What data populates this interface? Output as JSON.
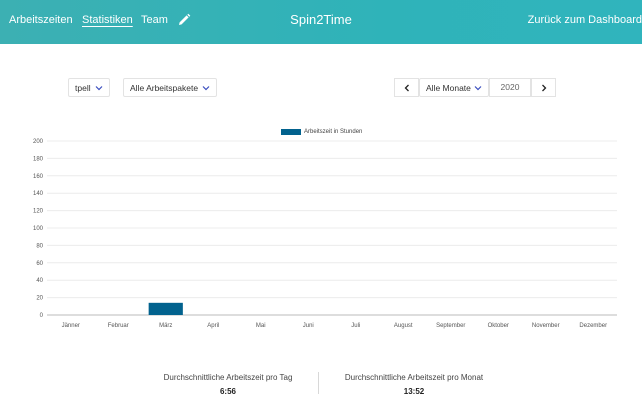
{
  "header": {
    "nav": [
      {
        "label": "Arbeitszeiten",
        "active": false
      },
      {
        "label": "Statistiken",
        "active": true
      },
      {
        "label": "Team",
        "active": false
      }
    ],
    "edit_icon": "pencil-icon",
    "title": "Spin2Time",
    "back_label": "Zurück zum Dashboard"
  },
  "filters": {
    "user_select": "tpell",
    "package_select": "Alle Arbeitspakete",
    "month_select": "Alle Monate",
    "year_value": "2020",
    "prev_icon": "chevron-left-icon",
    "next_icon": "chevron-right-icon"
  },
  "colors": {
    "header_bg": "#34b2b7",
    "bar": "#02628e"
  },
  "chart_data": {
    "type": "bar",
    "categories": [
      "Jänner",
      "Februar",
      "März",
      "April",
      "Mai",
      "Juni",
      "Juli",
      "August",
      "September",
      "Oktober",
      "November",
      "Dezember"
    ],
    "series": [
      {
        "name": "Arbeitszeit in Stunden",
        "values": [
          0,
          0,
          14,
          0,
          0,
          0,
          0,
          0,
          0,
          0,
          0,
          0
        ]
      }
    ],
    "yticks": [
      0,
      20,
      40,
      60,
      80,
      100,
      120,
      140,
      160,
      180,
      200
    ],
    "ylim": [
      0,
      200
    ],
    "grid": true,
    "legend": "top-center"
  },
  "stats": {
    "per_day_label": "Durchschnittliche Arbeitszeit pro Tag",
    "per_day_value": "6:56",
    "per_month_label": "Durchschnittliche Arbeitszeit pro Monat",
    "per_month_value": "13:52"
  }
}
